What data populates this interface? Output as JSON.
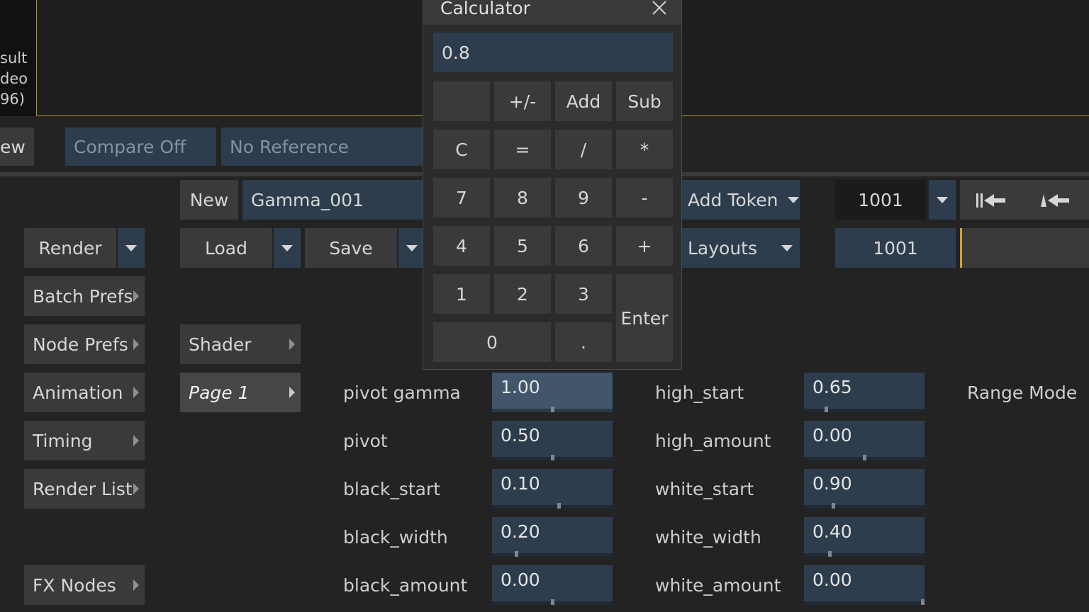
{
  "viewer": {
    "result_lines": [
      "sult",
      "deo",
      "96)"
    ]
  },
  "compare_bar": {
    "view_label": "ew",
    "compare_value": "Compare Off",
    "reference_value": "No Reference"
  },
  "toolbar": {
    "new_label": "New",
    "setup_name": "Gamma_001",
    "render_label": "Render",
    "load_label": "Load",
    "save_label": "Save",
    "add_token_label": "Add Token",
    "layouts_label": "Layouts",
    "frame_value": "1001",
    "current_frame": "1001"
  },
  "sidebar": {
    "items": [
      {
        "label": "Batch Prefs"
      },
      {
        "label": "Node Prefs"
      },
      {
        "label": "Animation"
      },
      {
        "label": "Timing"
      },
      {
        "label": "Render List"
      },
      {
        "label": "FX Nodes"
      }
    ]
  },
  "pages": {
    "shader_label": "Shader",
    "page_label": "Page 1"
  },
  "params": {
    "left": [
      {
        "label": "pivot gamma",
        "value": "1.00",
        "fraction": 0.5
      },
      {
        "label": "pivot",
        "value": "0.50",
        "fraction": 0.5
      },
      {
        "label": "black_start",
        "value": "0.10",
        "fraction": 0.55
      },
      {
        "label": "black_width",
        "value": "0.20",
        "fraction": 0.2
      },
      {
        "label": "black_amount",
        "value": "0.00",
        "fraction": 0.5
      }
    ],
    "right": [
      {
        "label": "high_start",
        "value": "0.65",
        "fraction": 0.18
      },
      {
        "label": "high_amount",
        "value": "0.00",
        "fraction": 0.5
      },
      {
        "label": "white_start",
        "value": "0.90",
        "fraction": 0.24
      },
      {
        "label": "white_width",
        "value": "0.40",
        "fraction": 0.21
      },
      {
        "label": "white_amount",
        "value": "0.00",
        "fraction": 1.0
      }
    ],
    "range_mode_label": "Range Mode"
  },
  "calculator": {
    "title": "Calculator",
    "display": "0.8",
    "keys": {
      "plusminus": "+/-",
      "add": "Add",
      "sub": "Sub",
      "clear": "C",
      "equals": "=",
      "divide": "/",
      "multiply": "*",
      "k7": "7",
      "k8": "8",
      "k9": "9",
      "minus": "-",
      "k4": "4",
      "k5": "5",
      "k6": "6",
      "plus": "+",
      "k1": "1",
      "k2": "2",
      "k3": "3",
      "enter": "Enter",
      "k0": "0",
      "dot": "."
    }
  },
  "colors": {
    "background": "#232323",
    "button": "#3a3a3a",
    "field_blue": "#2e3d4d",
    "accent_orange": "#b08a3a"
  }
}
